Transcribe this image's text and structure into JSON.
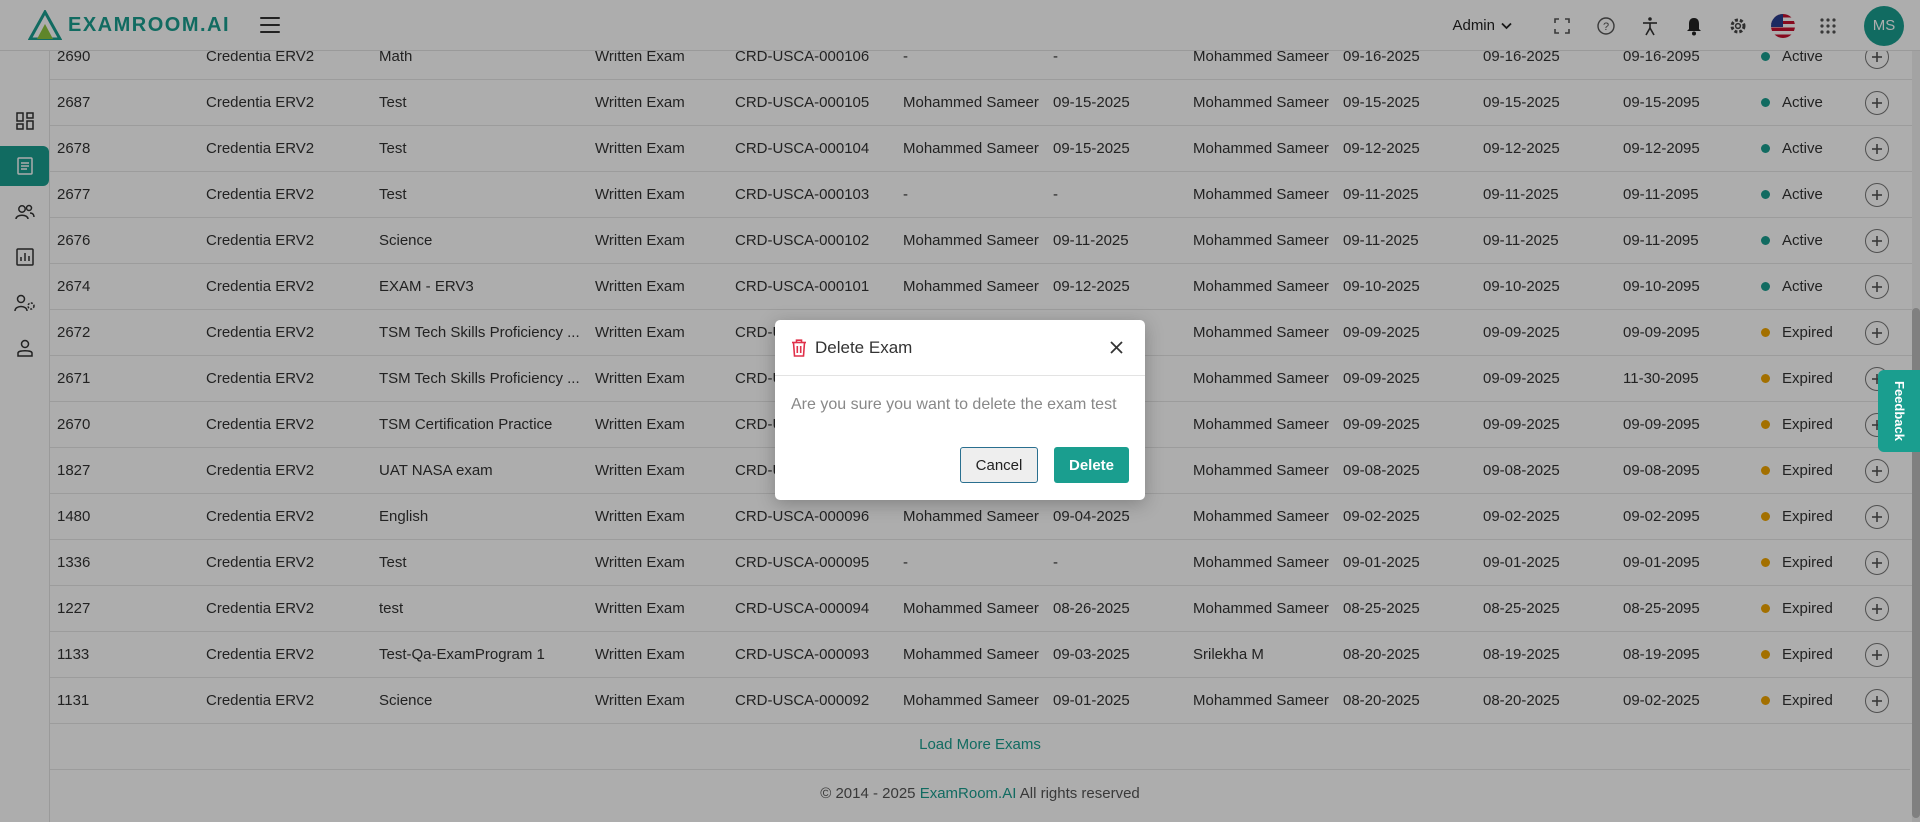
{
  "header": {
    "logo_text": "EXAMROOM.AI",
    "role": "Admin",
    "avatar_initials": "MS"
  },
  "table": {
    "rows": [
      {
        "id": "2690",
        "client": "Credentia ERV2",
        "name": "Math",
        "type": "Written Exam",
        "code": "CRD-USCA-000106",
        "created_by": "-",
        "created_on": "-",
        "updated_by": "Mohammed Sameer",
        "d1": "09-16-2025",
        "d2": "09-16-2025",
        "d3": "09-16-2095",
        "status": "Active"
      },
      {
        "id": "2687",
        "client": "Credentia ERV2",
        "name": "Test",
        "type": "Written Exam",
        "code": "CRD-USCA-000105",
        "created_by": "Mohammed Sameer",
        "created_on": "09-15-2025",
        "updated_by": "Mohammed Sameer",
        "d1": "09-15-2025",
        "d2": "09-15-2025",
        "d3": "09-15-2095",
        "status": "Active"
      },
      {
        "id": "2678",
        "client": "Credentia ERV2",
        "name": "Test",
        "type": "Written Exam",
        "code": "CRD-USCA-000104",
        "created_by": "Mohammed Sameer",
        "created_on": "09-15-2025",
        "updated_by": "Mohammed Sameer",
        "d1": "09-12-2025",
        "d2": "09-12-2025",
        "d3": "09-12-2095",
        "status": "Active"
      },
      {
        "id": "2677",
        "client": "Credentia ERV2",
        "name": "Test",
        "type": "Written Exam",
        "code": "CRD-USCA-000103",
        "created_by": "-",
        "created_on": "-",
        "updated_by": "Mohammed Sameer",
        "d1": "09-11-2025",
        "d2": "09-11-2025",
        "d3": "09-11-2095",
        "status": "Active"
      },
      {
        "id": "2676",
        "client": "Credentia ERV2",
        "name": "Science",
        "type": "Written Exam",
        "code": "CRD-USCA-000102",
        "created_by": "Mohammed Sameer",
        "created_on": "09-11-2025",
        "updated_by": "Mohammed Sameer",
        "d1": "09-11-2025",
        "d2": "09-11-2025",
        "d3": "09-11-2095",
        "status": "Active"
      },
      {
        "id": "2674",
        "client": "Credentia ERV2",
        "name": "EXAM - ERV3",
        "type": "Written Exam",
        "code": "CRD-USCA-000101",
        "created_by": "Mohammed Sameer",
        "created_on": "09-12-2025",
        "updated_by": "Mohammed Sameer",
        "d1": "09-10-2025",
        "d2": "09-10-2025",
        "d3": "09-10-2095",
        "status": "Active"
      },
      {
        "id": "2672",
        "client": "Credentia ERV2",
        "name": "TSM Tech Skills Proficiency ...",
        "type": "Written Exam",
        "code": "CRD-U",
        "created_by": "",
        "created_on": "",
        "updated_by": "Mohammed Sameer",
        "d1": "09-09-2025",
        "d2": "09-09-2025",
        "d3": "09-09-2095",
        "status": "Expired"
      },
      {
        "id": "2671",
        "client": "Credentia ERV2",
        "name": "TSM Tech Skills Proficiency ...",
        "type": "Written Exam",
        "code": "CRD-U",
        "created_by": "",
        "created_on": "",
        "updated_by": "Mohammed Sameer",
        "d1": "09-09-2025",
        "d2": "09-09-2025",
        "d3": "11-30-2095",
        "status": "Expired"
      },
      {
        "id": "2670",
        "client": "Credentia ERV2",
        "name": "TSM Certification Practice",
        "type": "Written Exam",
        "code": "CRD-U",
        "created_by": "",
        "created_on": "",
        "updated_by": "Mohammed Sameer",
        "d1": "09-09-2025",
        "d2": "09-09-2025",
        "d3": "09-09-2095",
        "status": "Expired"
      },
      {
        "id": "1827",
        "client": "Credentia ERV2",
        "name": "UAT NASA exam",
        "type": "Written Exam",
        "code": "CRD-U",
        "created_by": "",
        "created_on": "",
        "updated_by": "Mohammed Sameer",
        "d1": "09-08-2025",
        "d2": "09-08-2025",
        "d3": "09-08-2095",
        "status": "Expired"
      },
      {
        "id": "1480",
        "client": "Credentia ERV2",
        "name": "English",
        "type": "Written Exam",
        "code": "CRD-USCA-000096",
        "created_by": "Mohammed Sameer",
        "created_on": "09-04-2025",
        "updated_by": "Mohammed Sameer",
        "d1": "09-02-2025",
        "d2": "09-02-2025",
        "d3": "09-02-2095",
        "status": "Expired"
      },
      {
        "id": "1336",
        "client": "Credentia ERV2",
        "name": "Test",
        "type": "Written Exam",
        "code": "CRD-USCA-000095",
        "created_by": "-",
        "created_on": "-",
        "updated_by": "Mohammed Sameer",
        "d1": "09-01-2025",
        "d2": "09-01-2025",
        "d3": "09-01-2095",
        "status": "Expired"
      },
      {
        "id": "1227",
        "client": "Credentia ERV2",
        "name": "test",
        "type": "Written Exam",
        "code": "CRD-USCA-000094",
        "created_by": "Mohammed Sameer",
        "created_on": "08-26-2025",
        "updated_by": "Mohammed Sameer",
        "d1": "08-25-2025",
        "d2": "08-25-2025",
        "d3": "08-25-2095",
        "status": "Expired"
      },
      {
        "id": "1133",
        "client": "Credentia ERV2",
        "name": "Test-Qa-ExamProgram 1",
        "type": "Written Exam",
        "code": "CRD-USCA-000093",
        "created_by": "Mohammed Sameer",
        "created_on": "09-03-2025",
        "updated_by": "Srilekha M",
        "d1": "08-20-2025",
        "d2": "08-19-2025",
        "d3": "08-19-2095",
        "status": "Expired"
      },
      {
        "id": "1131",
        "client": "Credentia ERV2",
        "name": "Science",
        "type": "Written Exam",
        "code": "CRD-USCA-000092",
        "created_by": "Mohammed Sameer",
        "created_on": "09-01-2025",
        "updated_by": "Mohammed Sameer",
        "d1": "08-20-2025",
        "d2": "08-20-2025",
        "d3": "09-02-2025",
        "status": "Expired"
      }
    ]
  },
  "status_colors": {
    "Active": "#1a9e8f",
    "Expired": "#f0a500"
  },
  "load_more_label": "Load More Exams",
  "footer": {
    "prefix": "© 2014 - 2025 ",
    "brand": "ExamRoom.AI",
    "suffix": " All rights reserved"
  },
  "feedback_label": "Feedback",
  "modal": {
    "title": "Delete Exam",
    "message": "Are you sure you want to delete the exam test",
    "cancel_label": "Cancel",
    "delete_label": "Delete"
  }
}
